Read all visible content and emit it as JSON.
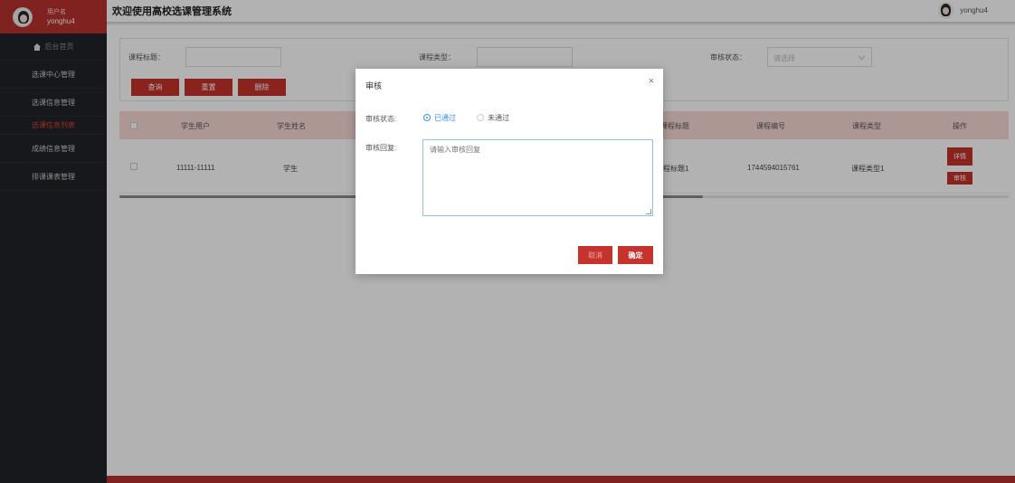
{
  "header": {
    "title": "欢迎使用高校选课管理系统",
    "user": "yonghu4"
  },
  "sidebar": {
    "user_role": "用户名",
    "user_name": "yonghu4",
    "items": [
      {
        "label": "后台首页"
      },
      {
        "label": "选课中心管理"
      },
      {
        "label": "选课信息管理"
      },
      {
        "label": "选课信息列表"
      },
      {
        "label": "成绩信息管理"
      },
      {
        "label": "排课课表管理"
      }
    ]
  },
  "search": {
    "course_title_label": "课程标题：",
    "course_type_label": "课程类型：",
    "status_label": "审核状态：",
    "status_placeholder": "请选择",
    "query_label": "查询",
    "reset_label": "重置",
    "delete_label": "删除"
  },
  "table": {
    "headers": [
      "学生用户",
      "学生姓名",
      "课程标题",
      "课程编号",
      "课程类型",
      "操作"
    ],
    "row": {
      "student_user": "11111-11111",
      "student_name": "学生",
      "course_title": "课程标题1",
      "course_no": "1744594015761",
      "course_type": "课程类型1",
      "detail_label": "详情",
      "review_label": "审核"
    }
  },
  "dialog": {
    "title": "审核",
    "close": "×",
    "status_label": "审核状态:",
    "option_pass": "已通过",
    "option_fail": "未通过",
    "reply_label": "审核回复:",
    "reply_placeholder": "请输入审核回复",
    "cancel_label": "取消",
    "ok_label": "确定"
  },
  "colors": {
    "primary": "#c6322c",
    "sidebar": "#222327",
    "accent": "#3a8ee6"
  }
}
